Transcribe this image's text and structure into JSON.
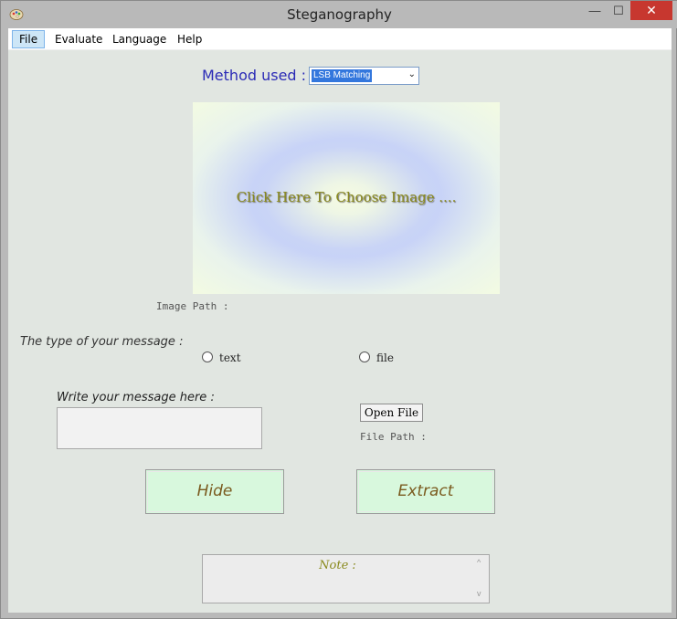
{
  "window": {
    "title": "Steganography",
    "minimize_glyph": "—",
    "maximize_glyph": "☐",
    "close_glyph": "✕",
    "app_icon": "paint-palette-icon"
  },
  "menu": {
    "items": [
      {
        "label": "File",
        "active": true
      },
      {
        "label": "Evaluate"
      },
      {
        "label": "Language"
      },
      {
        "label": "Help"
      }
    ]
  },
  "method": {
    "label": "Method used :",
    "selected": "LSB Matching",
    "arrow": "⌄"
  },
  "image_area": {
    "prompt": "Click Here To Choose Image ...."
  },
  "image_path": {
    "label": "Image Path :"
  },
  "message_type": {
    "label": "The type of your message :",
    "options": [
      {
        "label": "text",
        "checked": false
      },
      {
        "label": "file",
        "checked": false
      }
    ]
  },
  "message": {
    "label": "Write your message here :",
    "value": ""
  },
  "open_file": {
    "label": "Open File"
  },
  "file_path": {
    "label": "File Path :"
  },
  "actions": {
    "hide_label": "Hide",
    "extract_label": "Extract"
  },
  "note": {
    "label": "Note :",
    "scroll_up": "^",
    "scroll_down": "v"
  },
  "colors": {
    "accent_blue": "#2b2bb6",
    "button_green": "#d8f8dd",
    "olive_text": "#8a8a1e",
    "close_red": "#c7372f",
    "client_bg": "#e1e6e1"
  }
}
